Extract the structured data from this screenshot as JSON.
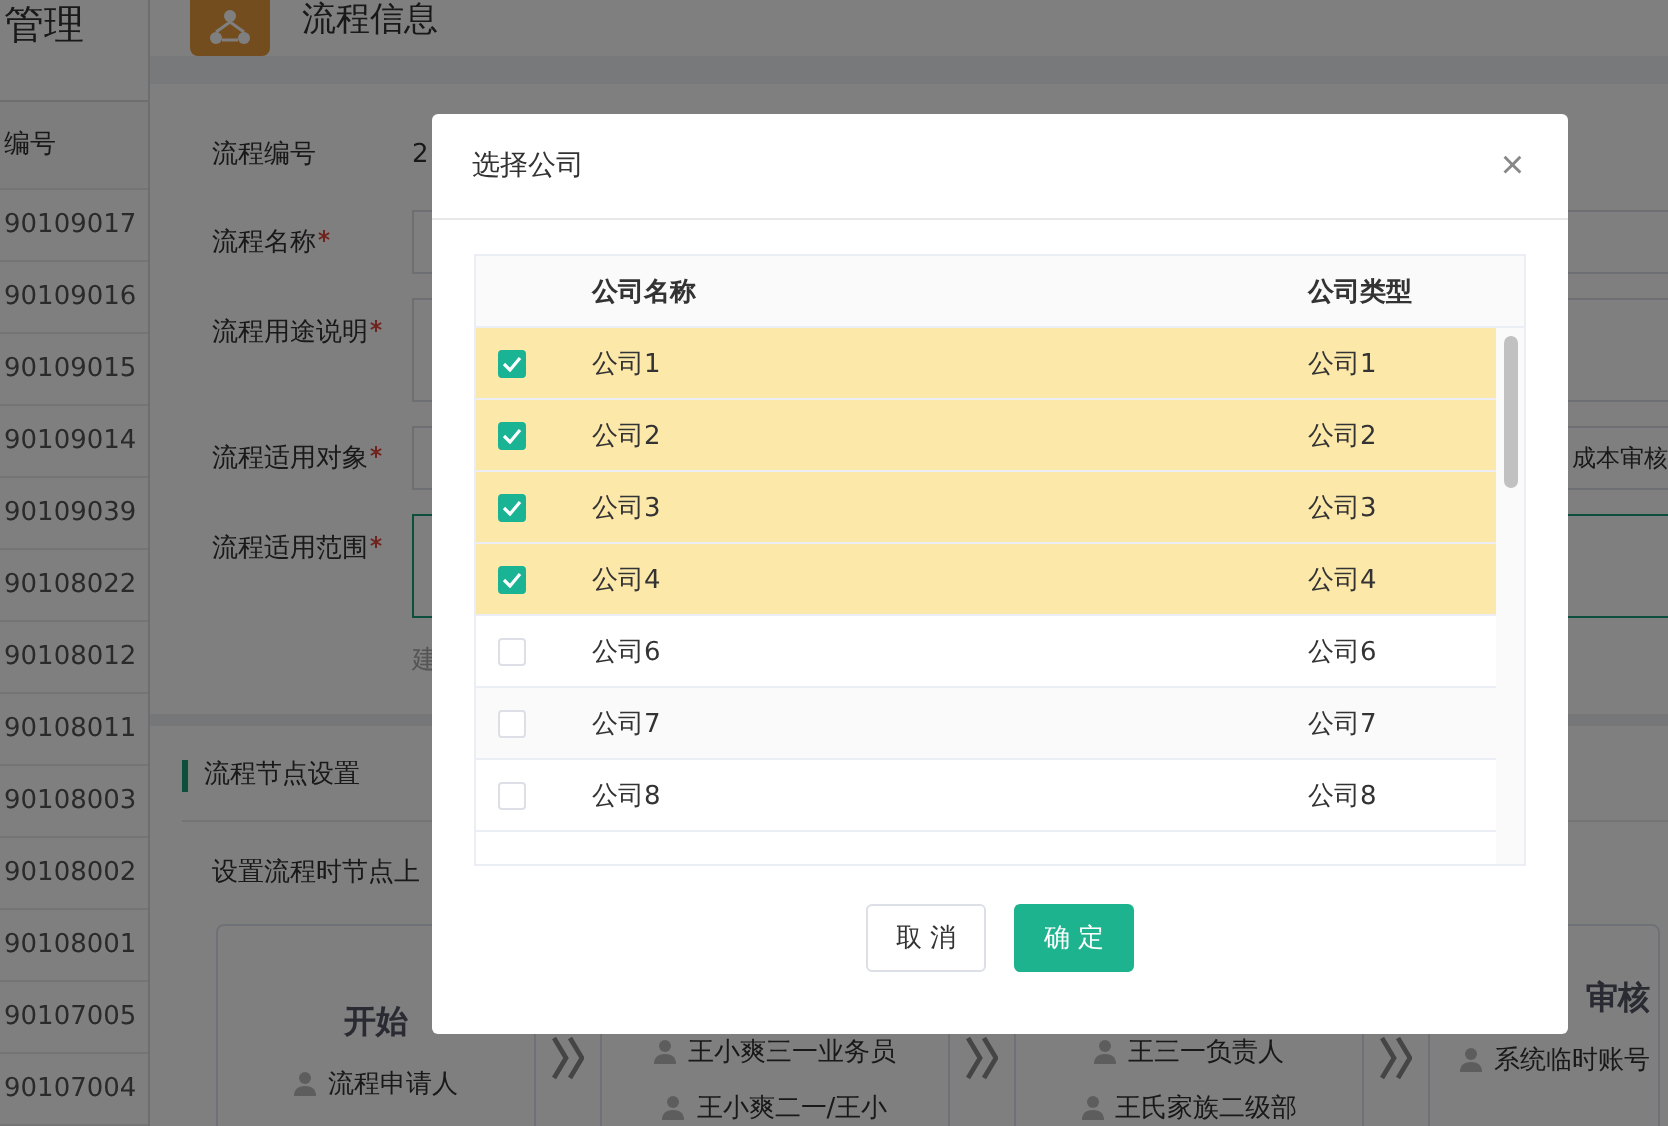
{
  "sidebar": {
    "title": "管理",
    "column_header": "编号",
    "rows": [
      "90109017",
      "90109016",
      "90109015",
      "90109014",
      "90109039",
      "90108022",
      "90108012",
      "90108011",
      "90108003",
      "90108002",
      "90108001",
      "90107005",
      "90107004"
    ]
  },
  "page": {
    "title": "流程信息",
    "form": [
      {
        "label": "流程编号",
        "required": false,
        "kind": "text",
        "value": "2"
      },
      {
        "label": "流程名称",
        "required": true,
        "kind": "input"
      },
      {
        "label": "流程用途说明",
        "required": true,
        "kind": "textarea"
      },
      {
        "label": "流程适用对象",
        "required": true,
        "kind": "input",
        "value": "成本审核"
      },
      {
        "label": "流程适用范围",
        "required": true,
        "kind": "focused_area",
        "hint": "建"
      }
    ],
    "section_title": "流程节点设置",
    "section_hint": "设置流程时节点上",
    "nodes": [
      {
        "title": "开始",
        "people": [
          "流程申请人"
        ]
      },
      {
        "people": [
          "王小爽三一业务员",
          "王小爽二一/王小"
        ]
      },
      {
        "people": [
          "王三一负责人",
          "王氏家族二级部"
        ]
      },
      {
        "title": "审核",
        "people": [
          "系统临时账号"
        ]
      }
    ]
  },
  "dialog": {
    "title": "选择公司",
    "close": "×",
    "columns": [
      "公司名称",
      "公司类型"
    ],
    "rows": [
      {
        "name": "公司1",
        "type": "公司1",
        "checked": true
      },
      {
        "name": "公司2",
        "type": "公司2",
        "checked": true
      },
      {
        "name": "公司3",
        "type": "公司3",
        "checked": true
      },
      {
        "name": "公司4",
        "type": "公司4",
        "checked": true
      },
      {
        "name": "公司6",
        "type": "公司6",
        "checked": false
      },
      {
        "name": "公司7",
        "type": "公司7",
        "checked": false
      },
      {
        "name": "公司8",
        "type": "公司8",
        "checked": false
      }
    ],
    "buttons": [
      {
        "label": "取 消",
        "kind": "secondary"
      },
      {
        "label": "确 定",
        "kind": "primary"
      }
    ]
  }
}
